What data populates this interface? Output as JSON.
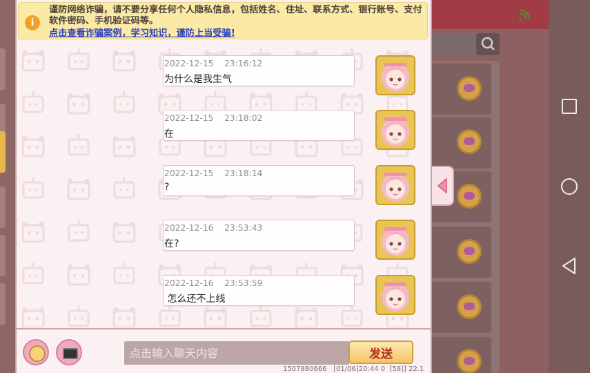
{
  "warning": {
    "text": "谨防网络诈骗，请不要分享任何个人隐私信息，包括姓名、住址、联系方式、银行账号、支付软件密码、手机验证码等。",
    "link": "点击查看诈骗案例，学习知识，谨防上当受骗!"
  },
  "messages": [
    {
      "date": "2022-12-15",
      "time": "23:16:12",
      "text": "为什么是我生气"
    },
    {
      "date": "2022-12-15",
      "time": "23:18:02",
      "text": "在"
    },
    {
      "date": "2022-12-15",
      "time": "23:18:14",
      "text": "?"
    },
    {
      "date": "2022-12-16",
      "time": "23:53:43",
      "text": "在?"
    },
    {
      "date": "2022-12-16",
      "time": "23:53:59",
      "text": " 怎么还不上线"
    }
  ],
  "input": {
    "placeholder": "点击输入聊天内容",
    "send_label": "发送"
  },
  "footer": {
    "info": "1507880666   [01/06]20:44 0  [58]] 22.1"
  },
  "colors": {
    "dialog_bg": "#fbf1f2",
    "warning_bg": "#fbeaa6",
    "link": "#2f3fbf",
    "send_text": "#b2301f",
    "avatar_bg": "#e4c04b"
  },
  "icons": {
    "warning": "info-icon",
    "emoji": "emoji-icon",
    "keyboard": "keyboard-icon",
    "collapse": "chevron-left-icon",
    "close": "close-icon",
    "search": "search-icon",
    "signal": "signal-icon"
  }
}
